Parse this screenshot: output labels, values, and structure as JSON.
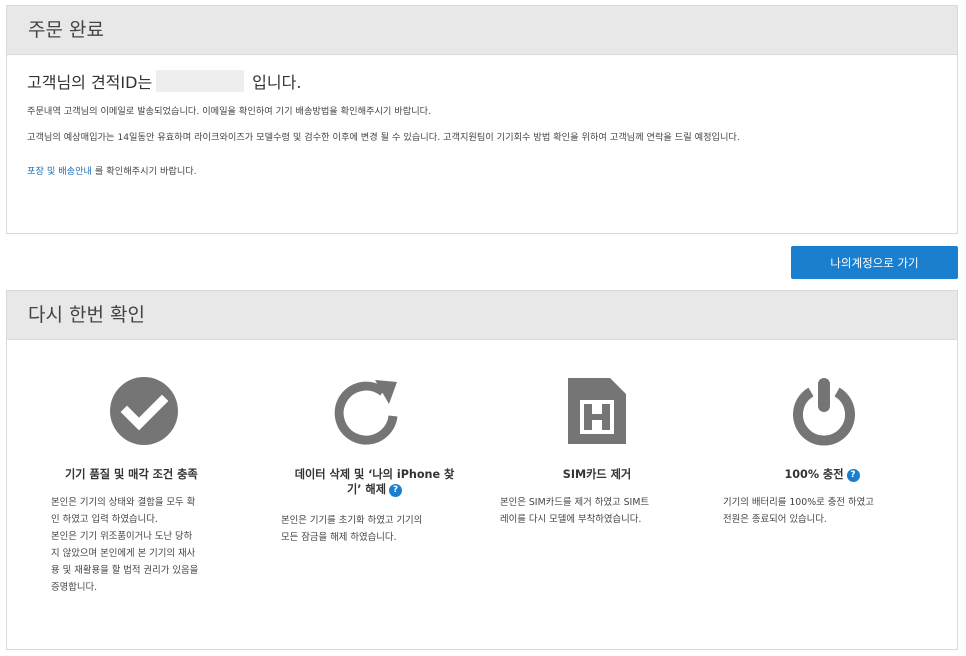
{
  "order": {
    "heading": "주문 완료",
    "quote_prefix": "고객님의 견적ID는",
    "quote_suffix": "입니다.",
    "line1": "주문내역 고객님의 이메일로 발송되었습니다. 이메일을 확인하여 기기 배송방법을 확인해주시기 바랍니다.",
    "line2": "고객님의 예상매입가는 14일동안 유효하며 라이크와이즈가 모델수령 및 검수한 이후에 변경 될 수 있습니다. 고객지원팀이 기기회수 방법 확인을 위하여 고객님께 연락을 드릴 예정입니다.",
    "link_text": "포장 및 배송안내",
    "link_suffix": " 를 확인해주시기 바랍니다."
  },
  "account_button": "나의계정으로 가기",
  "confirm": {
    "heading": "다시 한번 확인",
    "items": [
      {
        "icon": "check-circle-icon",
        "title": "기기 품질 및 매각 조건 충족",
        "text": [
          "본인은 기기의 상태와 결함을 모두 확",
          "인 하였고 입력 하였습니다.",
          "본인은 기기 위조품이거나 도난 당하",
          "지 않았으며 본인에게 본 기기의 재사",
          "용 및 재활용을 할 법적 권리가 있음을",
          "증명합니다."
        ]
      },
      {
        "icon": "refresh-icon",
        "title1": "데이터 삭제 및 ‘나의 iPhone 찾",
        "title2": "기’ 해제",
        "text": [
          "본인은 기기를 초기화 하였고 기기의",
          "모든 잠금을 해제 하였습니다."
        ]
      },
      {
        "icon": "sim-card-icon",
        "title": "SIM카드 제거",
        "text": [
          "본인은 SIM카드를 제거 하였고 SIM트",
          "레이를 다시 모델에 부착하였습니다."
        ]
      },
      {
        "icon": "power-icon",
        "title": "100% 충전",
        "text": [
          "기기의 배터리를 100%로 충전 하였고",
          "전원은 종료되어 있습니다."
        ]
      }
    ],
    "help_glyph": "?"
  },
  "colors": {
    "accent": "#1a7fcf",
    "icon_gray": "#757575",
    "header_bg": "#e8e8e8"
  }
}
